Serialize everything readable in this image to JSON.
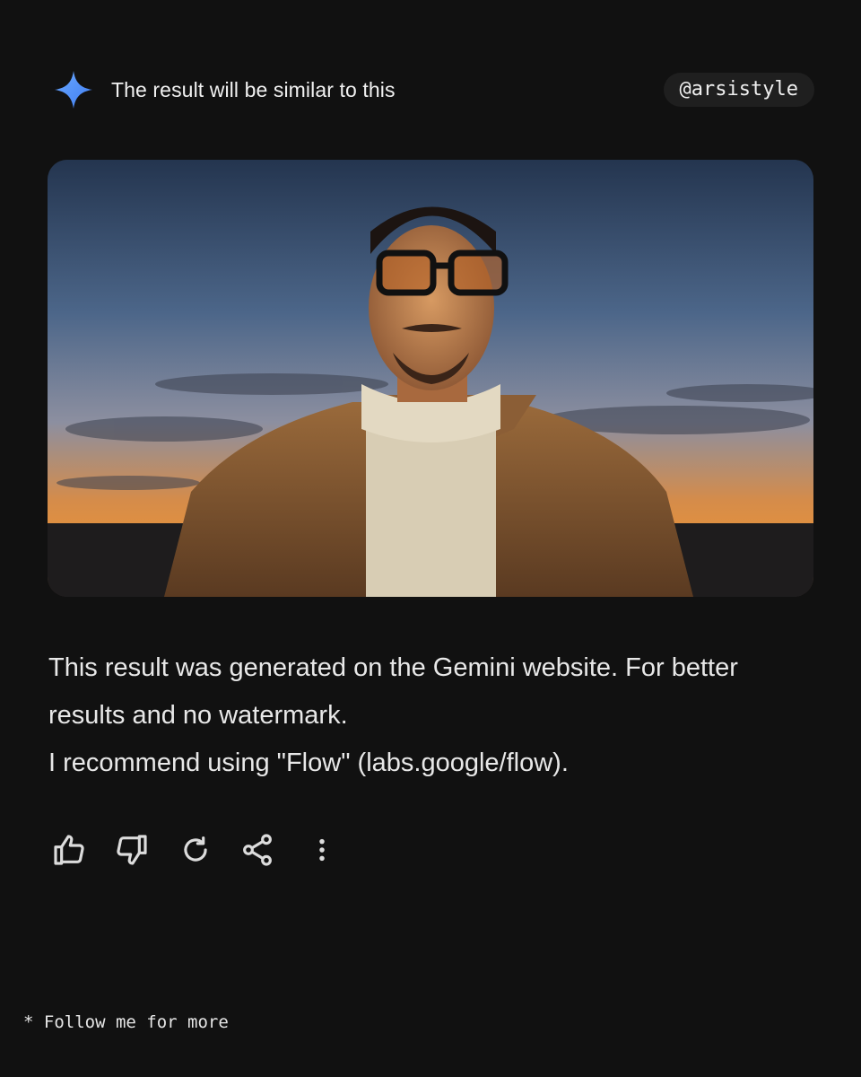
{
  "header": {
    "icon": "gemini-sparkle-icon",
    "title": "The result will be similar to this",
    "handle": "@arsistyle"
  },
  "image": {
    "description_kind": "photo-portrait-at-sunset"
  },
  "description": {
    "line1": "This result was generated on the Gemini website. For better results and no watermark.",
    "line2": "I recommend using \"Flow\" (labs.google/flow)."
  },
  "actions": [
    {
      "icon": "thumbs-up-icon"
    },
    {
      "icon": "thumbs-down-icon"
    },
    {
      "icon": "regenerate-icon"
    },
    {
      "icon": "share-icon"
    },
    {
      "icon": "more-vert-icon"
    }
  ],
  "footer": {
    "text": "* Follow me for more"
  },
  "colors": {
    "background": "#111111",
    "accent": "#4f8ff7",
    "text": "#e8e8e8"
  }
}
